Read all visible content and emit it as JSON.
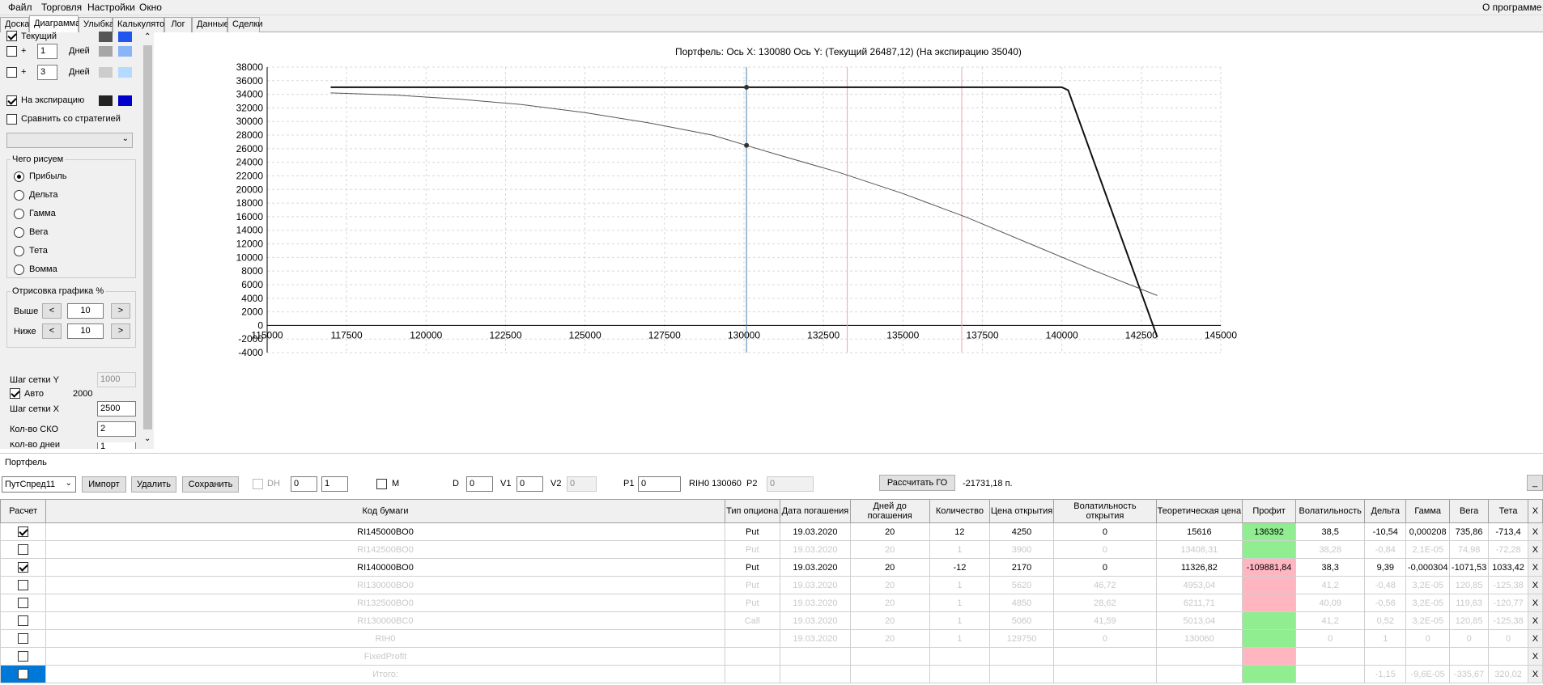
{
  "menu": {
    "file": "Файл",
    "trade": "Торговля",
    "settings": "Настройки",
    "window": "Окно",
    "about": "О программе"
  },
  "tabs": [
    "Доска",
    "Диаграмма",
    "Улыбка",
    "Калькулятор",
    "Лог",
    "Данные",
    "Сделки"
  ],
  "left": {
    "current_label": "Текущий",
    "plus1_label": "+",
    "plus1_value": "1",
    "days1": "Дней",
    "plus2_label": "+",
    "plus2_value": "3",
    "days2": "Дней",
    "expiry_label": "На экспирацию",
    "compare_label": "Сравнить со стратегией",
    "draw_group": "Чего рисуем",
    "radios": [
      "Прибыль",
      "Дельта",
      "Гамма",
      "Вега",
      "Тета",
      "Вомма"
    ],
    "render_group": "Отрисовка графика %",
    "above_label": "Выше",
    "above_value": "10",
    "below_label": "Ниже",
    "below_value": "10",
    "prev": "<",
    "next": ">",
    "gridy_label": "Шаг сетки Y",
    "gridy_value": "1000",
    "auto_label": "Авто",
    "auto_value": "2000",
    "gridx_label": "Шаг сетки X",
    "gridx_value": "2500",
    "sko_label": "Кол-во СКО",
    "sko_value": "2",
    "days_label": "Кол-во дней",
    "days_value": "1",
    "colors": {
      "cur1": "#555555",
      "cur2": "#2255ee",
      "p1a": "#a6a6a6",
      "p1b": "#8ab4f8",
      "p2a": "#cccccc",
      "p2b": "#b3dbff",
      "exp1": "#222222",
      "exp2": "#0000cc"
    }
  },
  "chart_data": {
    "type": "line",
    "title": "Портфель: Ось X: 130080 Ось Y:  (Текущий 26487,12)  (На экспирацию 35040)",
    "xlim": [
      115000,
      145000
    ],
    "ylim": [
      -4000,
      38000
    ],
    "xticks": [
      "115000",
      "117500",
      "120000",
      "122500",
      "125000",
      "127500",
      "130000",
      "132500",
      "135000",
      "137500",
      "140000",
      "142500",
      "145000"
    ],
    "yticks": [
      "38000",
      "36000",
      "34000",
      "32000",
      "30000",
      "28000",
      "26000",
      "24000",
      "22000",
      "20000",
      "18000",
      "16000",
      "14000",
      "12000",
      "10000",
      "8000",
      "6000",
      "4000",
      "2000",
      "0",
      "-2000",
      "-4000"
    ],
    "vlines": [
      {
        "x": 133250,
        "color": "#f4a0a8"
      },
      {
        "x": 130080,
        "color": "#4a7fb0"
      },
      {
        "x": 136850,
        "color": "#f4a0a8"
      }
    ],
    "series": [
      {
        "color": "#111111",
        "width": 2,
        "points": [
          [
            117000,
            35040
          ],
          [
            140000,
            35040
          ],
          [
            140200,
            34600
          ],
          [
            143000,
            -1700
          ]
        ]
      },
      {
        "color": "#555555",
        "width": 1,
        "points": [
          [
            117000,
            34200
          ],
          [
            119000,
            33900
          ],
          [
            121000,
            33300
          ],
          [
            123000,
            32500
          ],
          [
            125000,
            31300
          ],
          [
            127000,
            29800
          ],
          [
            129000,
            28000
          ],
          [
            130080,
            26487
          ],
          [
            131000,
            25200
          ],
          [
            133000,
            22500
          ],
          [
            135000,
            19400
          ],
          [
            137000,
            15900
          ],
          [
            139000,
            12000
          ],
          [
            141000,
            8100
          ],
          [
            143000,
            4400
          ]
        ]
      }
    ],
    "markers": [
      [
        130080,
        35040
      ],
      [
        130080,
        26487
      ]
    ]
  },
  "portfolio": {
    "label": "Портфель",
    "strategy": "ПутСпред11",
    "import": "Импорт",
    "delete": "Удалить",
    "save": "Сохранить",
    "dh_label": "DH",
    "dh1": "0",
    "dh2": "1",
    "m_label": "M",
    "d_label": "D",
    "d_value": "0",
    "v1_label": "V1",
    "v1_value": "0",
    "v2_label": "V2",
    "v2_value": "0",
    "p1_label": "P1",
    "p1_value": "0",
    "rih_label": "RIH0 130060",
    "p2_label": "P2",
    "p2_value": "0",
    "calc_go": "Рассчитать ГО",
    "go_value": "-21731,18 п.",
    "minimize": "_"
  },
  "table": {
    "headers": [
      "Расчет",
      "Код бумаги",
      "Тип опциона",
      "Дата погашения",
      "Дней до погашения",
      "Количество",
      "Цена открытия",
      "Волатильность открытия",
      "Теоретическая цена",
      "Профит",
      "Волатильность",
      "Дельта",
      "Гамма",
      "Вега",
      "Тета",
      "X"
    ],
    "rows": [
      {
        "checked": true,
        "active": true,
        "cells": [
          "RI145000BO0",
          "Put",
          "19.03.2020",
          "20",
          "12",
          "4250",
          "0",
          "15616",
          "136392",
          "38,5",
          "-10,54",
          "0,000208",
          "735,86",
          "-713,4"
        ],
        "profit": "green"
      },
      {
        "checked": false,
        "active": false,
        "cells": [
          "RI142500BO0",
          "Put",
          "19.03.2020",
          "20",
          "1",
          "3900",
          "0",
          "13408,31",
          "",
          "38,28",
          "-0,84",
          "2,1E-05",
          "74,98",
          "-72,28"
        ],
        "profit": "green"
      },
      {
        "checked": true,
        "active": true,
        "cells": [
          "RI140000BO0",
          "Put",
          "19.03.2020",
          "20",
          "-12",
          "2170",
          "0",
          "11326,82",
          "-109881,84",
          "38,3",
          "9,39",
          "-0,000304",
          "-1071,53",
          "1033,42"
        ],
        "profit": "pink"
      },
      {
        "checked": false,
        "active": false,
        "cells": [
          "RI130000BO0",
          "Put",
          "19.03.2020",
          "20",
          "1",
          "5620",
          "46,72",
          "4953,04",
          "",
          "41,2",
          "-0,48",
          "3,2E-05",
          "120,85",
          "-125,38"
        ],
        "profit": "pink"
      },
      {
        "checked": false,
        "active": false,
        "cells": [
          "RI132500BO0",
          "Put",
          "19.03.2020",
          "20",
          "1",
          "4850",
          "28,62",
          "6211,71",
          "",
          "40,09",
          "-0,56",
          "3,2E-05",
          "119,63",
          "-120,77"
        ],
        "profit": "pink"
      },
      {
        "checked": false,
        "active": false,
        "cells": [
          "RI130000BC0",
          "Call",
          "19.03.2020",
          "20",
          "1",
          "5060",
          "41,59",
          "5013,04",
          "",
          "41,2",
          "0,52",
          "3,2E-05",
          "120,85",
          "-125,38"
        ],
        "profit": "green"
      },
      {
        "checked": false,
        "active": false,
        "cells": [
          "RIH0",
          "",
          "19.03.2020",
          "20",
          "1",
          "129750",
          "0",
          "130060",
          "",
          "0",
          "1",
          "0",
          "0",
          "0"
        ],
        "profit": "green"
      },
      {
        "checked": false,
        "active": false,
        "cells": [
          "FixedProfit",
          "",
          "",
          "",
          "",
          "",
          "",
          "",
          "",
          "",
          "",
          "",
          "",
          ""
        ],
        "profit": "pink"
      },
      {
        "checked": false,
        "active": false,
        "selected": true,
        "cells": [
          "Итого:",
          "",
          "",
          "",
          "",
          "",
          "",
          "",
          "",
          "",
          "-1,15",
          "-9,6E-05",
          "-335,67",
          "320,02"
        ],
        "profit": "green"
      }
    ],
    "xbtn": "X"
  }
}
